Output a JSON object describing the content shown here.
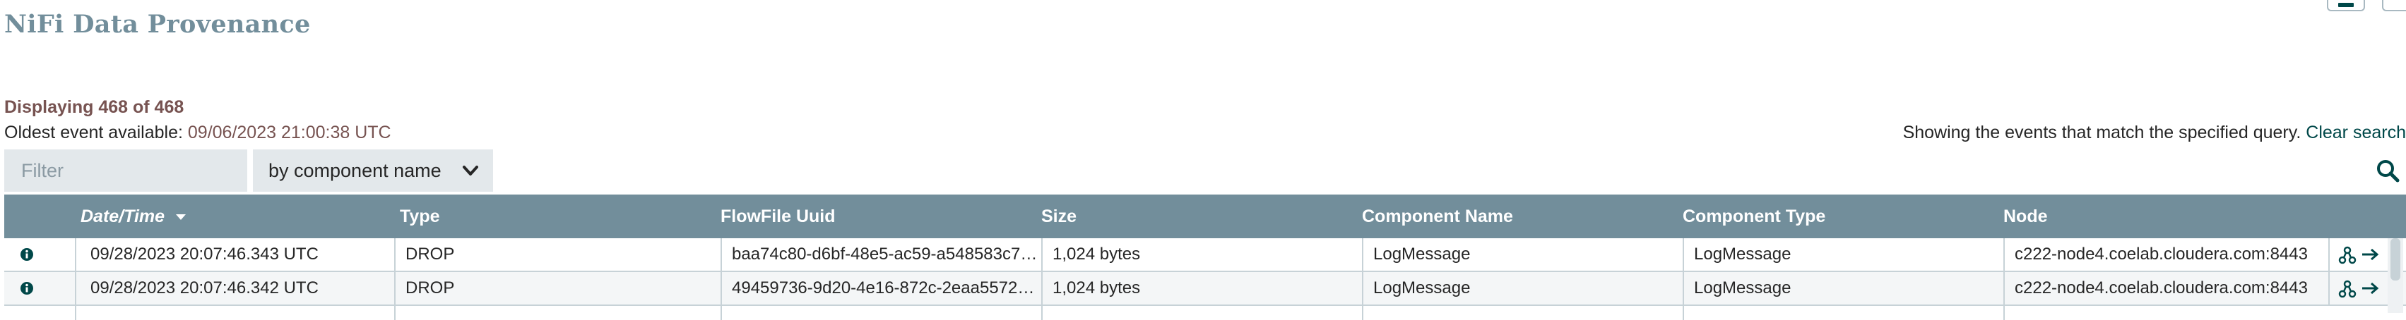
{
  "page": {
    "title": "NiFi Data Provenance"
  },
  "summary": {
    "displaying": "Displaying 468 of 468",
    "oldest_label": "Oldest event available: ",
    "oldest_value": "09/06/2023 21:00:38 UTC",
    "query_text": "Showing the events that match the specified query. ",
    "clear_search": "Clear search"
  },
  "filter": {
    "placeholder": "Filter",
    "value": "",
    "selected_option": "by component name"
  },
  "table": {
    "columns": [
      "",
      "Date/Time",
      "Type",
      "FlowFile Uuid",
      "Size",
      "Component Name",
      "Component Type",
      "Node",
      ""
    ],
    "sorted_column": "Date/Time",
    "sort_direction": "descending",
    "rows": [
      {
        "datetime": "09/28/2023 20:07:46.343 UTC",
        "type": "DROP",
        "uuid": "baa74c80-d6bf-48e5-ac59-a548583c7…",
        "size": "1,024 bytes",
        "component_name": "LogMessage",
        "component_type": "LogMessage",
        "node": "c222-node4.coelab.cloudera.com:8443"
      },
      {
        "datetime": "09/28/2023 20:07:46.342 UTC",
        "type": "DROP",
        "uuid": "49459736-9d20-4e16-872c-2eaa5572…",
        "size": "1,024 bytes",
        "component_name": "LogMessage",
        "component_type": "LogMessage",
        "node": "c222-node4.coelab.cloudera.com:8443"
      }
    ]
  },
  "icons": {
    "info": "info-icon",
    "lineage": "lineage-icon",
    "goto": "goto-icon",
    "search": "search-icon",
    "chevron": "chevron-down-icon"
  },
  "colors": {
    "header_bg": "#728e9b",
    "title": "#728e9b",
    "value_accent": "#775351",
    "link": "#004849",
    "input_bg": "#e3e8eb"
  }
}
